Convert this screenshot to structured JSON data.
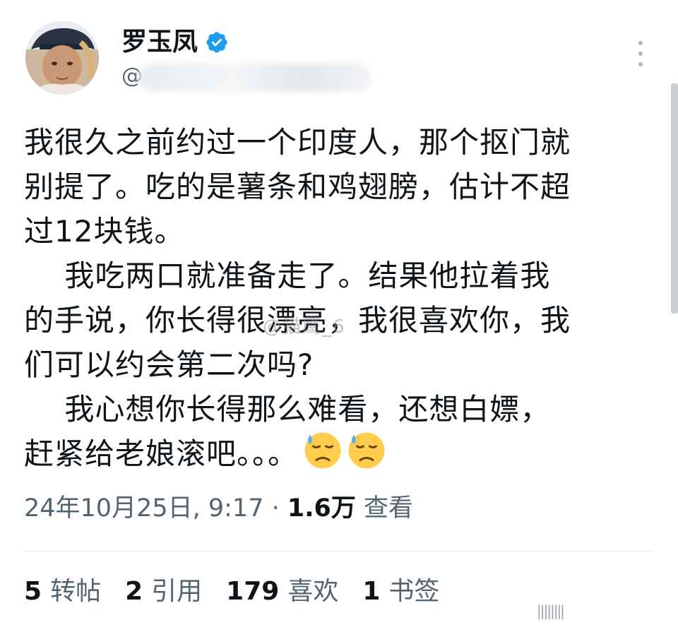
{
  "user": {
    "display_name": "罗玉凤",
    "handle": "@",
    "verified": true
  },
  "tweet": {
    "lines": [
      "我很久之前约过一个印度人，那个抠门就",
      "别提了。吃的是薯条和鸡翅膀，估计不超",
      "过12块钱。",
      "    我吃两口就准备走了。结果他拉着我",
      "的手说，你长得很漂亮，我很喜欢你，我",
      "们可以约会第二次吗?",
      "    我心想你长得那么难看，还想白嫖，",
      "赶紧给老娘滚吧。。。"
    ],
    "emojis": [
      "downcast-face-with-sweat-emoji",
      "downcast-face-with-sweat-emoji"
    ]
  },
  "meta": {
    "timestamp": "24年10月25日, 9:17",
    "separator": "·",
    "views_count": "1.6万",
    "views_label": "查看"
  },
  "stats": [
    {
      "count": "5",
      "label": "转帖"
    },
    {
      "count": "2",
      "label": "引用"
    },
    {
      "count": "179",
      "label": "喜欢"
    },
    {
      "count": "1",
      "label": "书签"
    }
  ],
  "watermark": "@猫鹰_6",
  "bottom_mark": "||||||||",
  "colors": {
    "verified": "#1d9bf0",
    "text": "#0f1419",
    "secondary": "#536471"
  }
}
